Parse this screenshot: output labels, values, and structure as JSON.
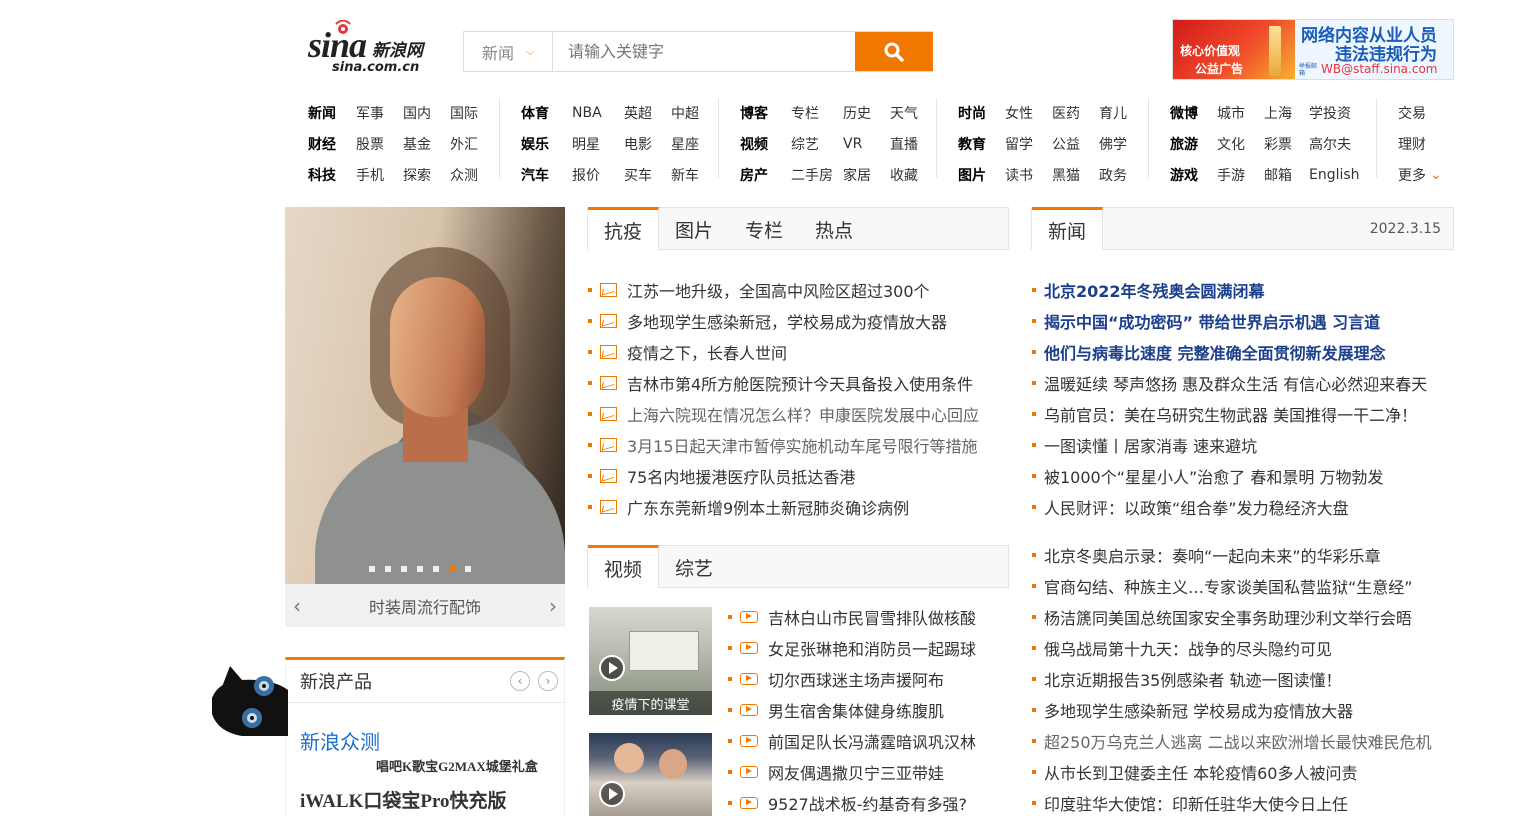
{
  "header": {
    "logo_sina": "sina",
    "logo_cn": "新浪网",
    "logo_domain": "sina.com.cn",
    "search_category": "新闻",
    "search_placeholder": "请输入关键字",
    "ad_left_line1": "核心价值观",
    "ad_left_line2": "公益广告",
    "ad_right_line1": "网络内容从业人员",
    "ad_right_line2": "违法违规行为",
    "ad_right_small": "举报邮箱",
    "ad_right_email": "WB@staff.sina.com"
  },
  "nav": {
    "groups": [
      {
        "rows": [
          [
            "新闻",
            "军事",
            "国内",
            "国际"
          ],
          [
            "财经",
            "股票",
            "基金",
            "外汇"
          ],
          [
            "科技",
            "手机",
            "探索",
            "众测"
          ]
        ]
      },
      {
        "rows": [
          [
            "体育",
            "NBA",
            "英超",
            "中超"
          ],
          [
            "娱乐",
            "明星",
            "电影",
            "星座"
          ],
          [
            "汽车",
            "报价",
            "买车",
            "新车"
          ]
        ]
      },
      {
        "rows": [
          [
            "博客",
            "专栏",
            "历史",
            "天气"
          ],
          [
            "视频",
            "综艺",
            "VR",
            "直播"
          ],
          [
            "房产",
            "二手房",
            "家居",
            "收藏"
          ]
        ]
      },
      {
        "rows": [
          [
            "时尚",
            "女性",
            "医药",
            "育儿"
          ],
          [
            "教育",
            "留学",
            "公益",
            "佛学"
          ],
          [
            "图片",
            "读书",
            "黑猫",
            "政务"
          ]
        ]
      },
      {
        "rows": [
          [
            "微博",
            "城市",
            "上海",
            "学投资"
          ],
          [
            "旅游",
            "文化",
            "彩票",
            "高尔夫"
          ],
          [
            "游戏",
            "手游",
            "邮箱",
            "English"
          ]
        ]
      },
      {
        "rows": [
          [
            "交易"
          ],
          [
            "理财"
          ],
          [
            "更多"
          ]
        ]
      }
    ]
  },
  "slide": {
    "caption": "时装周流行配饰",
    "prev": "‹",
    "next": "›"
  },
  "products": {
    "title": "新浪产品",
    "line1": "新浪众测",
    "line2": "唱吧K歌宝G2MAX城堡礼盒",
    "line3": "iWALK口袋宝Pro快充版"
  },
  "tabs_mid": [
    "抗疫",
    "图片",
    "专栏",
    "热点"
  ],
  "mid_news": [
    "江苏一地升级，全国高中风险区超过300个",
    "多地现学生感染新冠，学校易成为疫情放大器",
    "疫情之下，长春人世间",
    "吉林市第4所方舱医院预计今天具备投入使用条件",
    "上海六院现在情况怎么样？申康医院发展中心回应",
    "3月15日起天津市暂停实施机动车尾号限行等措施",
    "75名内地援港医疗队员抵达香港",
    "广东东莞新增9例本土新冠肺炎确诊病例"
  ],
  "tabs_video": [
    "视频",
    "综艺"
  ],
  "video_thumb_label": "疫情下的课堂",
  "video_news": [
    "吉林白山市民冒雪排队做核酸",
    "女足张琳艳和消防员一起踢球",
    "切尔西球迷主场声援阿布",
    "男生宿舍集体健身练腹肌",
    "前国足队长冯潇霆暗讽巩汉林",
    "网友偶遇撒贝宁三亚带娃",
    "9527战术板-约基奇有多强?"
  ],
  "right_tab": "新闻",
  "right_date": "2022.3.15",
  "right_news_bold": [
    "北京2022年冬残奥会圆满闭幕",
    "揭示中国“成功密码” 带给世界启示机遇 习言道",
    "他们与病毒比速度 完整准确全面贯彻新发展理念"
  ],
  "right_news": [
    "温暖延续 琴声悠扬 惠及群众生活 有信心必然迎来春天",
    "乌前官员：美在乌研究生物武器 美国推得一干二净！",
    "一图读懂丨居家消毒 速来避坑",
    "被1000个“星星小人”治愈了 春和景明 万物勃发",
    "人民财评：以政策“组合拳”发力稳经济大盘"
  ],
  "right_news2": [
    "北京冬奥启示录：奏响“一起向未来”的华彩乐章",
    "官商勾结、种族主义…专家谈美国私营监狱“生意经”",
    "杨洁篪同美国总统国家安全事务助理沙利文举行会晤",
    "俄乌战局第十九天：战争的尽头隐约可见",
    "北京近期报告35例感染者 轨迹一图读懂！",
    "多地现学生感染新冠 学校易成为疫情放大器",
    "超250万乌克兰人逃离 二战以来欧洲增长最快难民危机",
    "从市长到卫健委主任 本轮疫情60多人被问责",
    "印度驻华大使馆：印新任驻华大使今日上任"
  ],
  "colors": {
    "accent": "#f07800",
    "link_blue": "#1c3f8c",
    "brand_red": "#e4393c"
  }
}
